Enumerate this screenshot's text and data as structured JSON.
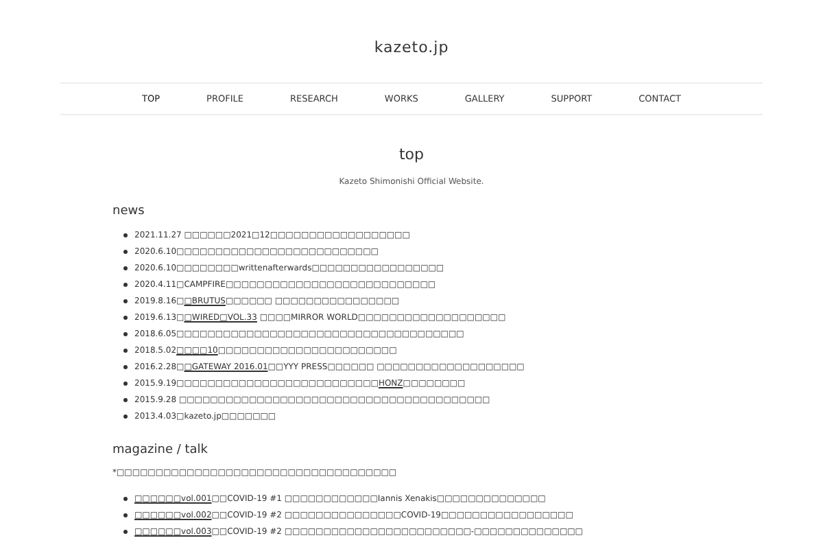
{
  "site_title": "kazeto.jp",
  "nav": [
    {
      "label": "TOP",
      "selected": true
    },
    {
      "label": "PROFILE",
      "selected": false
    },
    {
      "label": "RESEARCH",
      "selected": false
    },
    {
      "label": "WORKS",
      "selected": false
    },
    {
      "label": "GALLERY",
      "selected": false
    },
    {
      "label": "SUPPORT",
      "selected": false
    },
    {
      "label": "CONTACT",
      "selected": false
    }
  ],
  "page_title": "top",
  "subtitle": "Kazeto Shimonishi Official Website.",
  "news": {
    "heading": "news",
    "items": [
      [
        {
          "kind": "plain",
          "text": "2021.11.27 □□□□□□2021□12□□□□□□□□□□□□□□□□□□"
        }
      ],
      [
        {
          "kind": "plain",
          "text": "2020.6.10□□□□□□□□□□□□□□□□□□□□□□□□□□"
        }
      ],
      [
        {
          "kind": "plain",
          "text": "2020.6.10□□□□□□□□writtenafterwards□□□□□□□□□□□□□□□□□"
        }
      ],
      [
        {
          "kind": "plain",
          "text": "2020.4.11□CAMPFIRE□□□□□□□□□□□□□□□□□□□□□□□□□□□"
        }
      ],
      [
        {
          "kind": "plain",
          "text": "2019.8.16□"
        },
        {
          "kind": "link",
          "text": "□BRUTUS"
        },
        {
          "kind": "plain",
          "text": "□□□□□□ □□□□□□□□□□□□□□□□"
        }
      ],
      [
        {
          "kind": "plain",
          "text": "2019.6.13□"
        },
        {
          "kind": "link",
          "text": "□WIRED□VOL.33"
        },
        {
          "kind": "plain",
          "text": " □□□□MIRROR WORLD□□□□□□□□□□□□□□□□□□□"
        }
      ],
      [
        {
          "kind": "plain",
          "text": "2018.6.05□□□□□□□□□□□□□□□□□□□□□□□□□□□□□□□□□□□□□"
        }
      ],
      [
        {
          "kind": "plain",
          "text": "2018.5.02"
        },
        {
          "kind": "link",
          "text": "□□□□10"
        },
        {
          "kind": "plain",
          "text": "□□□□□□□□□□□□□□□□□□□□□□□"
        }
      ],
      [
        {
          "kind": "plain",
          "text": "2016.2.28□"
        },
        {
          "kind": "link",
          "text": "□GATEWAY 2016.01"
        },
        {
          "kind": "plain",
          "text": "□□YYY PRESS□□□□□□ □□□□□□□□□□□□□□□□□□□"
        }
      ],
      [
        {
          "kind": "plain",
          "text": "2015.9.19□□□□□□□□□□□□□□□□□□□□□□□□□□"
        },
        {
          "kind": "link",
          "text": "HONZ"
        },
        {
          "kind": "plain",
          "text": "□□□□□□□□"
        }
      ],
      [
        {
          "kind": "plain",
          "text": "2015.9.28 □□□□□□□□□□□□□□□□□□□□□□□□□□□□□□□□□□□□□□□□"
        }
      ],
      [
        {
          "kind": "plain",
          "text": "2013.4.03□kazeto.jp□□□□□□□"
        }
      ]
    ]
  },
  "magazine": {
    "heading": "magazine / talk",
    "note": "*□□□□□□□□□□□□□□□□□□□□□□□□□□□□□□□□□□□□",
    "items": [
      [
        {
          "kind": "link",
          "text": "□□□□□□vol.001"
        },
        {
          "kind": "plain",
          "text": "□□COVID-19 #1 □□□□□□□□□□□□Iannis Xenakis□□□□□□□□□□□□□□"
        }
      ],
      [
        {
          "kind": "link",
          "text": "□□□□□□vol.002"
        },
        {
          "kind": "plain",
          "text": "□□COVID-19 #2 □□□□□□□□□□□□□□□COVID-19□□□□□□□□□□□□□□□□□"
        }
      ],
      [
        {
          "kind": "link",
          "text": "□□□□□□vol.003"
        },
        {
          "kind": "plain",
          "text": "□□COVID-19 #2 □□□□□□□□□□□□□□□□□□□□□□□□-□□□□□□□□□□□□□□"
        }
      ]
    ]
  }
}
